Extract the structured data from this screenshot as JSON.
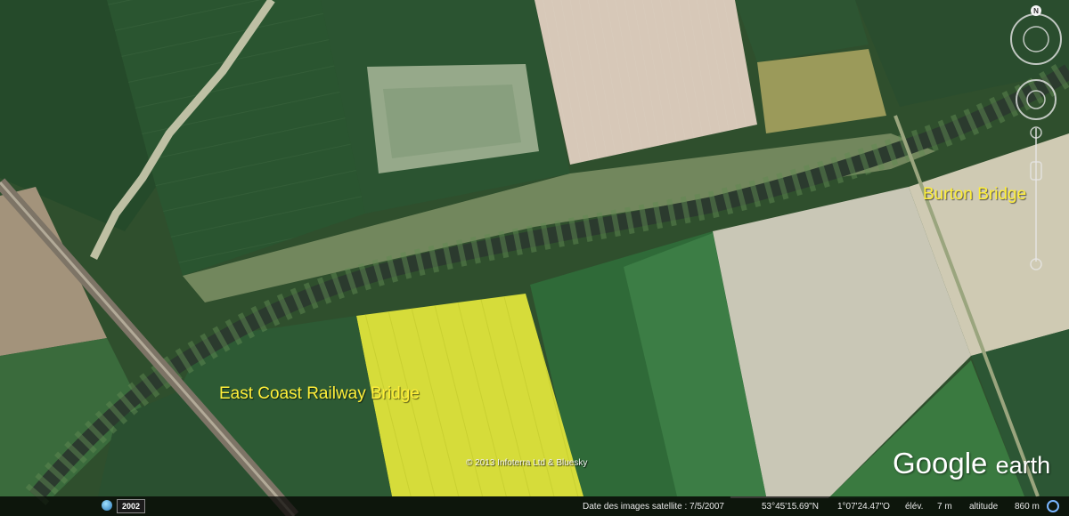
{
  "labels": {
    "railway_bridge": "East Coast Railway Bridge",
    "burton_bridge": "Burton Bridge"
  },
  "copyright": "© 2013 Infoterra Ltd & Bluesky",
  "brand": {
    "main": "Google",
    "suffix": "earth"
  },
  "navigation": {
    "compass_letter": "N"
  },
  "status": {
    "historical_year": "2002",
    "imagery_date": "Date des images satellite : 7/5/2007",
    "latitude": "53°45'15.69\"N",
    "longitude": "1°07'24.47\"O",
    "elevation_label": "élév.",
    "elevation_value": "7 m",
    "altitude_label": "altitude",
    "altitude_value": "860 m"
  },
  "colors": {
    "label_text": "#ffef3a",
    "rapeseed_field": "#d6dc3a",
    "river": "#2b3a2e",
    "statusbar": "#000000"
  }
}
